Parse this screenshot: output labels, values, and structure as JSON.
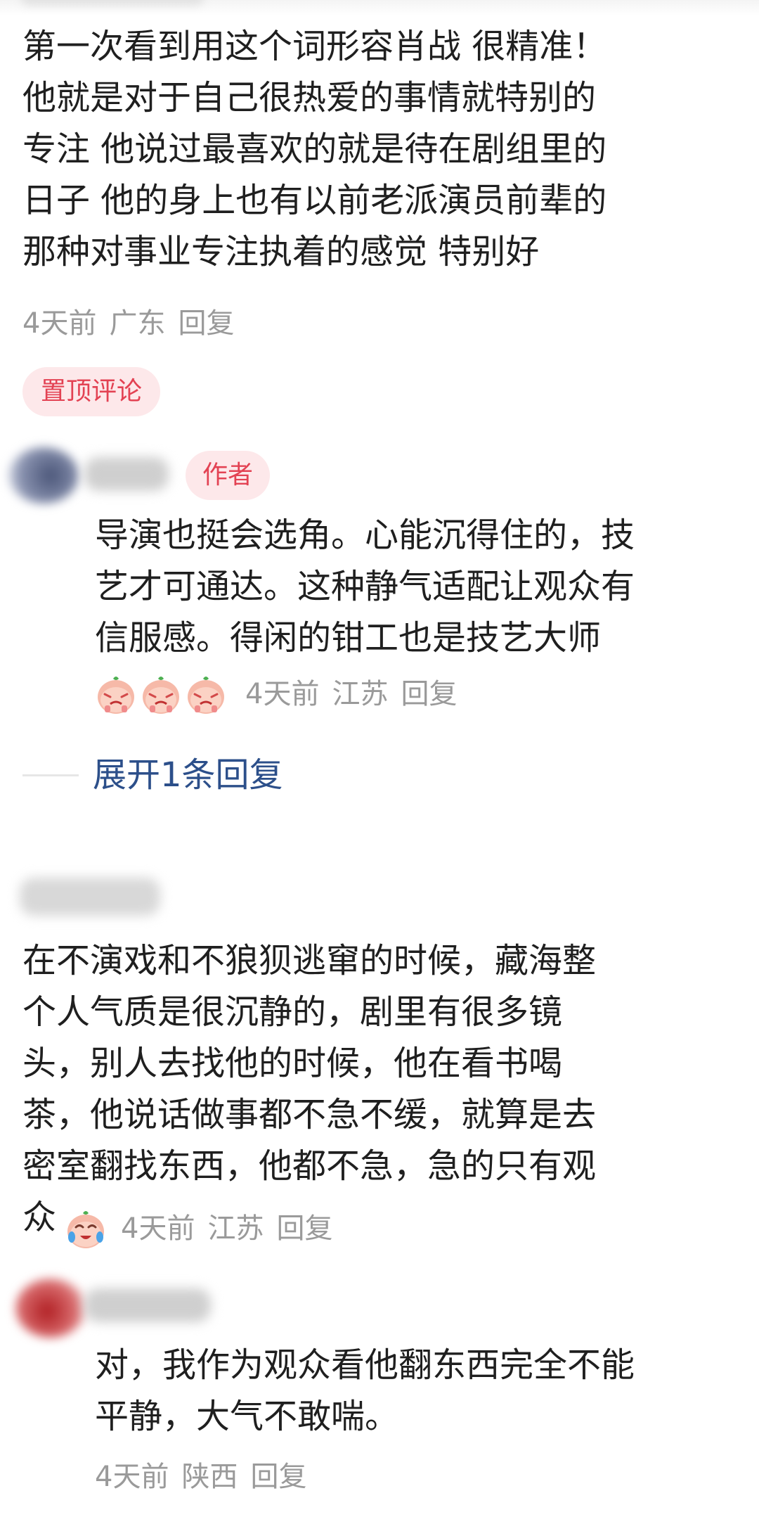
{
  "comment1": {
    "text": "第一次看到用这个词形容肖战 很精准！\n他就是对于自己很热爱的事情就特别的\n专注 他说过最喜欢的就是待在剧组里的\n日子 他的身上也有以前老派演员前辈的\n那种对事业专注执着的感觉 特别好",
    "time": "4天前",
    "location": "广东",
    "reply_label": "回复"
  },
  "pinned_label": "置顶评论",
  "reply1": {
    "author_badge": "作者",
    "text": "导演也挺会选角。心能沉得住的，技\n艺才可通达。这种静气适配让观众有\n信服感。得闲的钳工也是技艺大师",
    "emoji": "crying-face-emoji",
    "time": "4天前",
    "location": "江苏",
    "reply_label": "回复"
  },
  "expand_label": "展开1条回复",
  "comment2": {
    "text": "在不演戏和不狼狈逃窜的时候，藏海整\n个人气质是很沉静的，剧里有很多镜\n头，别人去找他的时候，他在看书喝\n茶，他说话做事都不急不缓，就算是去\n密室翻找东西，他都不急，急的只有观\n众",
    "emoji": "laugh-cry-emoji",
    "time": "4天前",
    "location": "江苏",
    "reply_label": "回复"
  },
  "reply2": {
    "text": "对，我作为观众看他翻东西完全不能\n平静，大气不敢喘。",
    "time": "4天前",
    "location": "陕西",
    "reply_label": "回复"
  },
  "colors": {
    "badge_bg": "#fde8ea",
    "badge_text": "#e34253",
    "link": "#2c4f8a",
    "meta": "#9a9a9a"
  }
}
